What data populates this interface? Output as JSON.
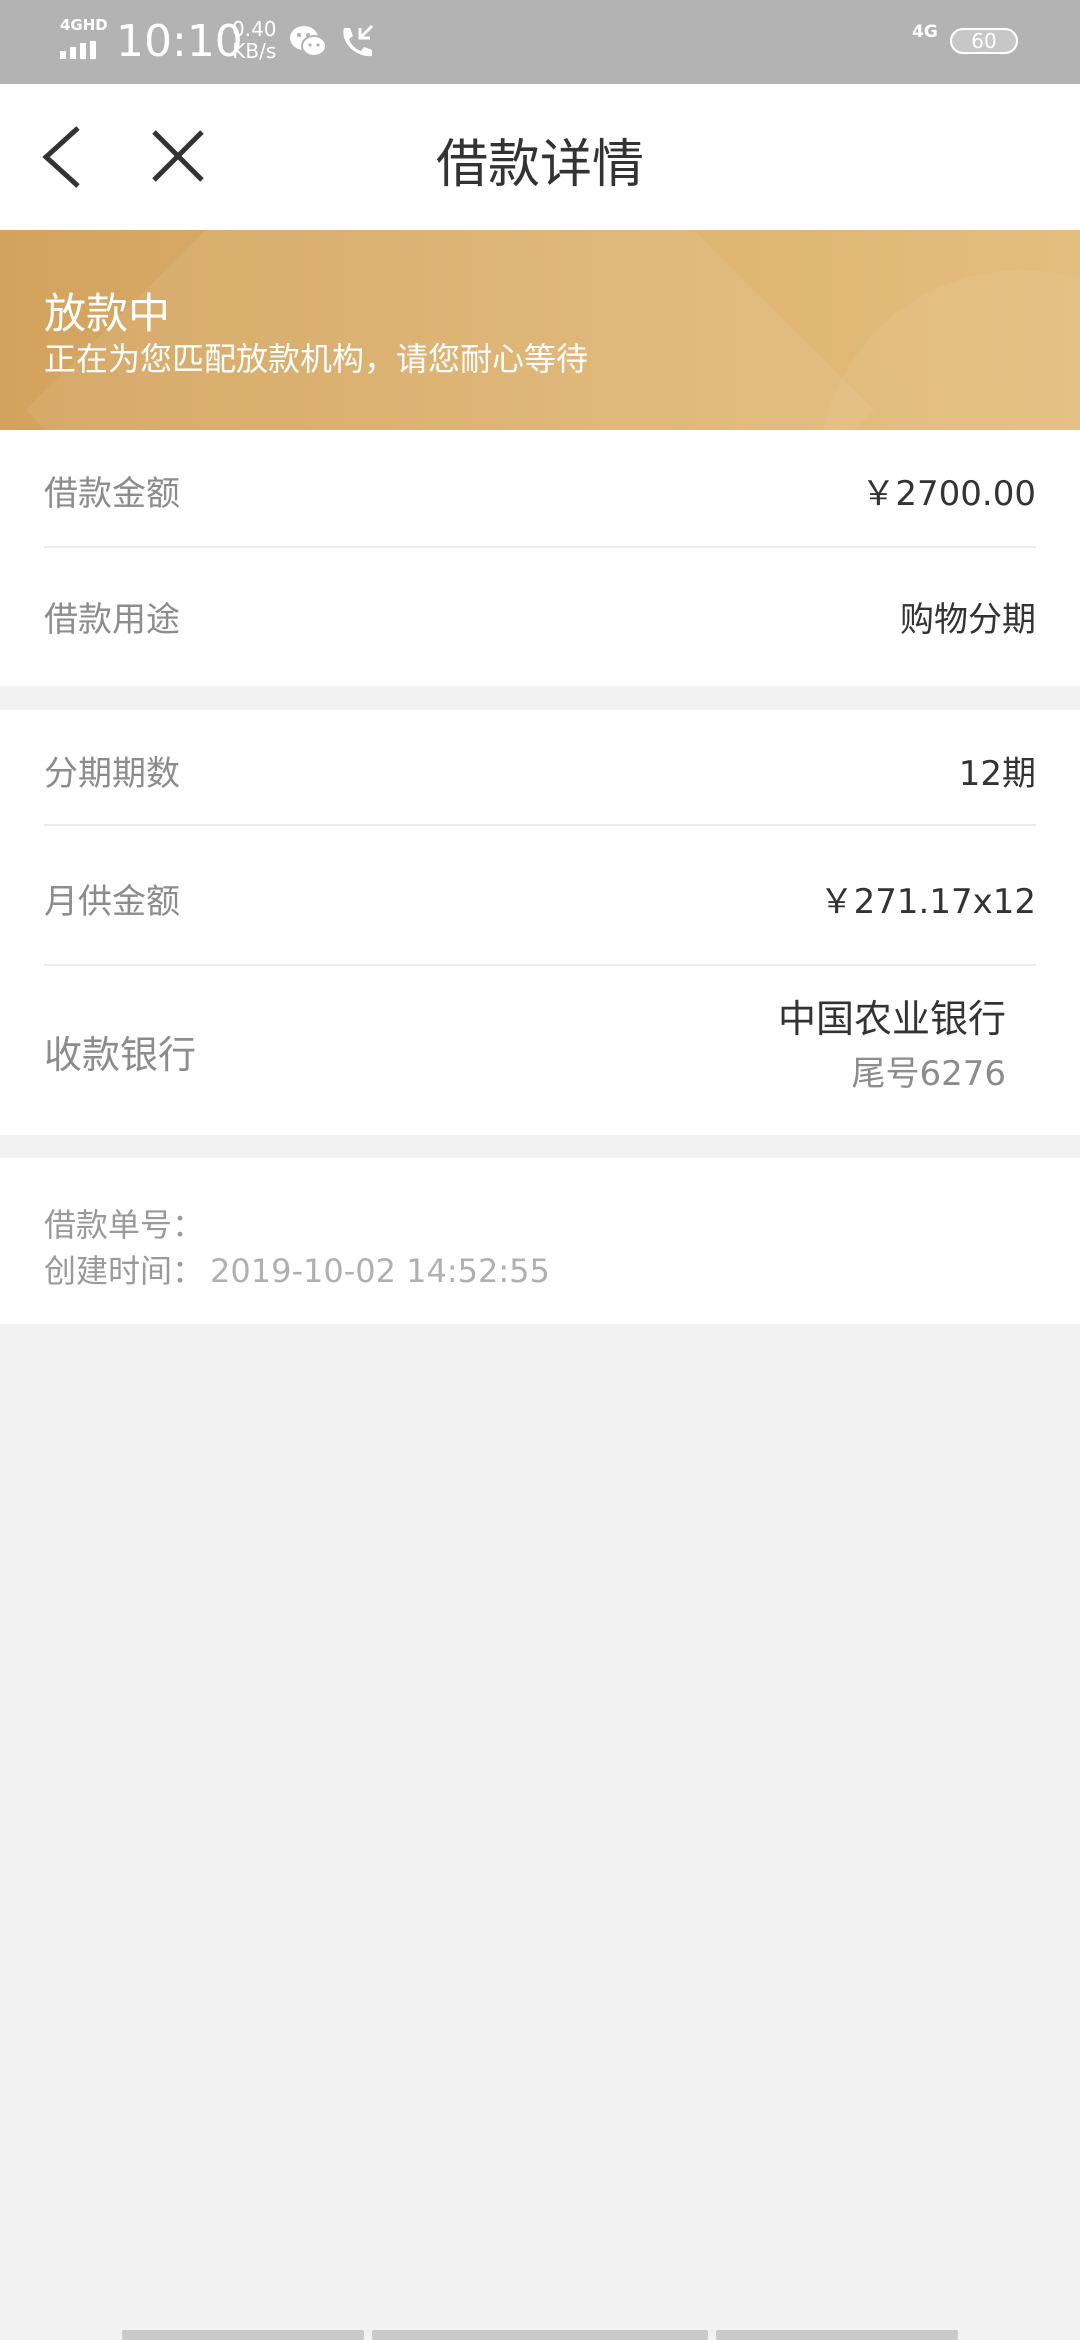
{
  "status_bar": {
    "network": "4GHD",
    "time": "10:10",
    "speed_value": "0.40",
    "speed_unit": "KB/s",
    "right_network": "4G",
    "battery": "60"
  },
  "nav": {
    "title": "借款详情",
    "back_icon": "chevron-left-icon",
    "close_icon": "close-icon"
  },
  "banner": {
    "title": "放款中",
    "subtitle": "正在为您匹配放款机构，请您耐心等待",
    "color": "#d9ab66"
  },
  "loan_info": {
    "amount_label": "借款金额",
    "amount_value": "￥2700.00",
    "purpose_label": "借款用途",
    "purpose_value": "购物分期"
  },
  "installment_info": {
    "periods_label": "分期期数",
    "periods_value": "12期",
    "monthly_label": "月供金额",
    "monthly_value": "￥271.17x12",
    "bank_label": "收款银行",
    "bank_name": "中国农业银行",
    "bank_tail": "尾号6276"
  },
  "meta": {
    "order_label": "借款单号：",
    "order_value": "",
    "created_label": "创建时间：",
    "created_value": "2019-10-02 14:52:55"
  }
}
